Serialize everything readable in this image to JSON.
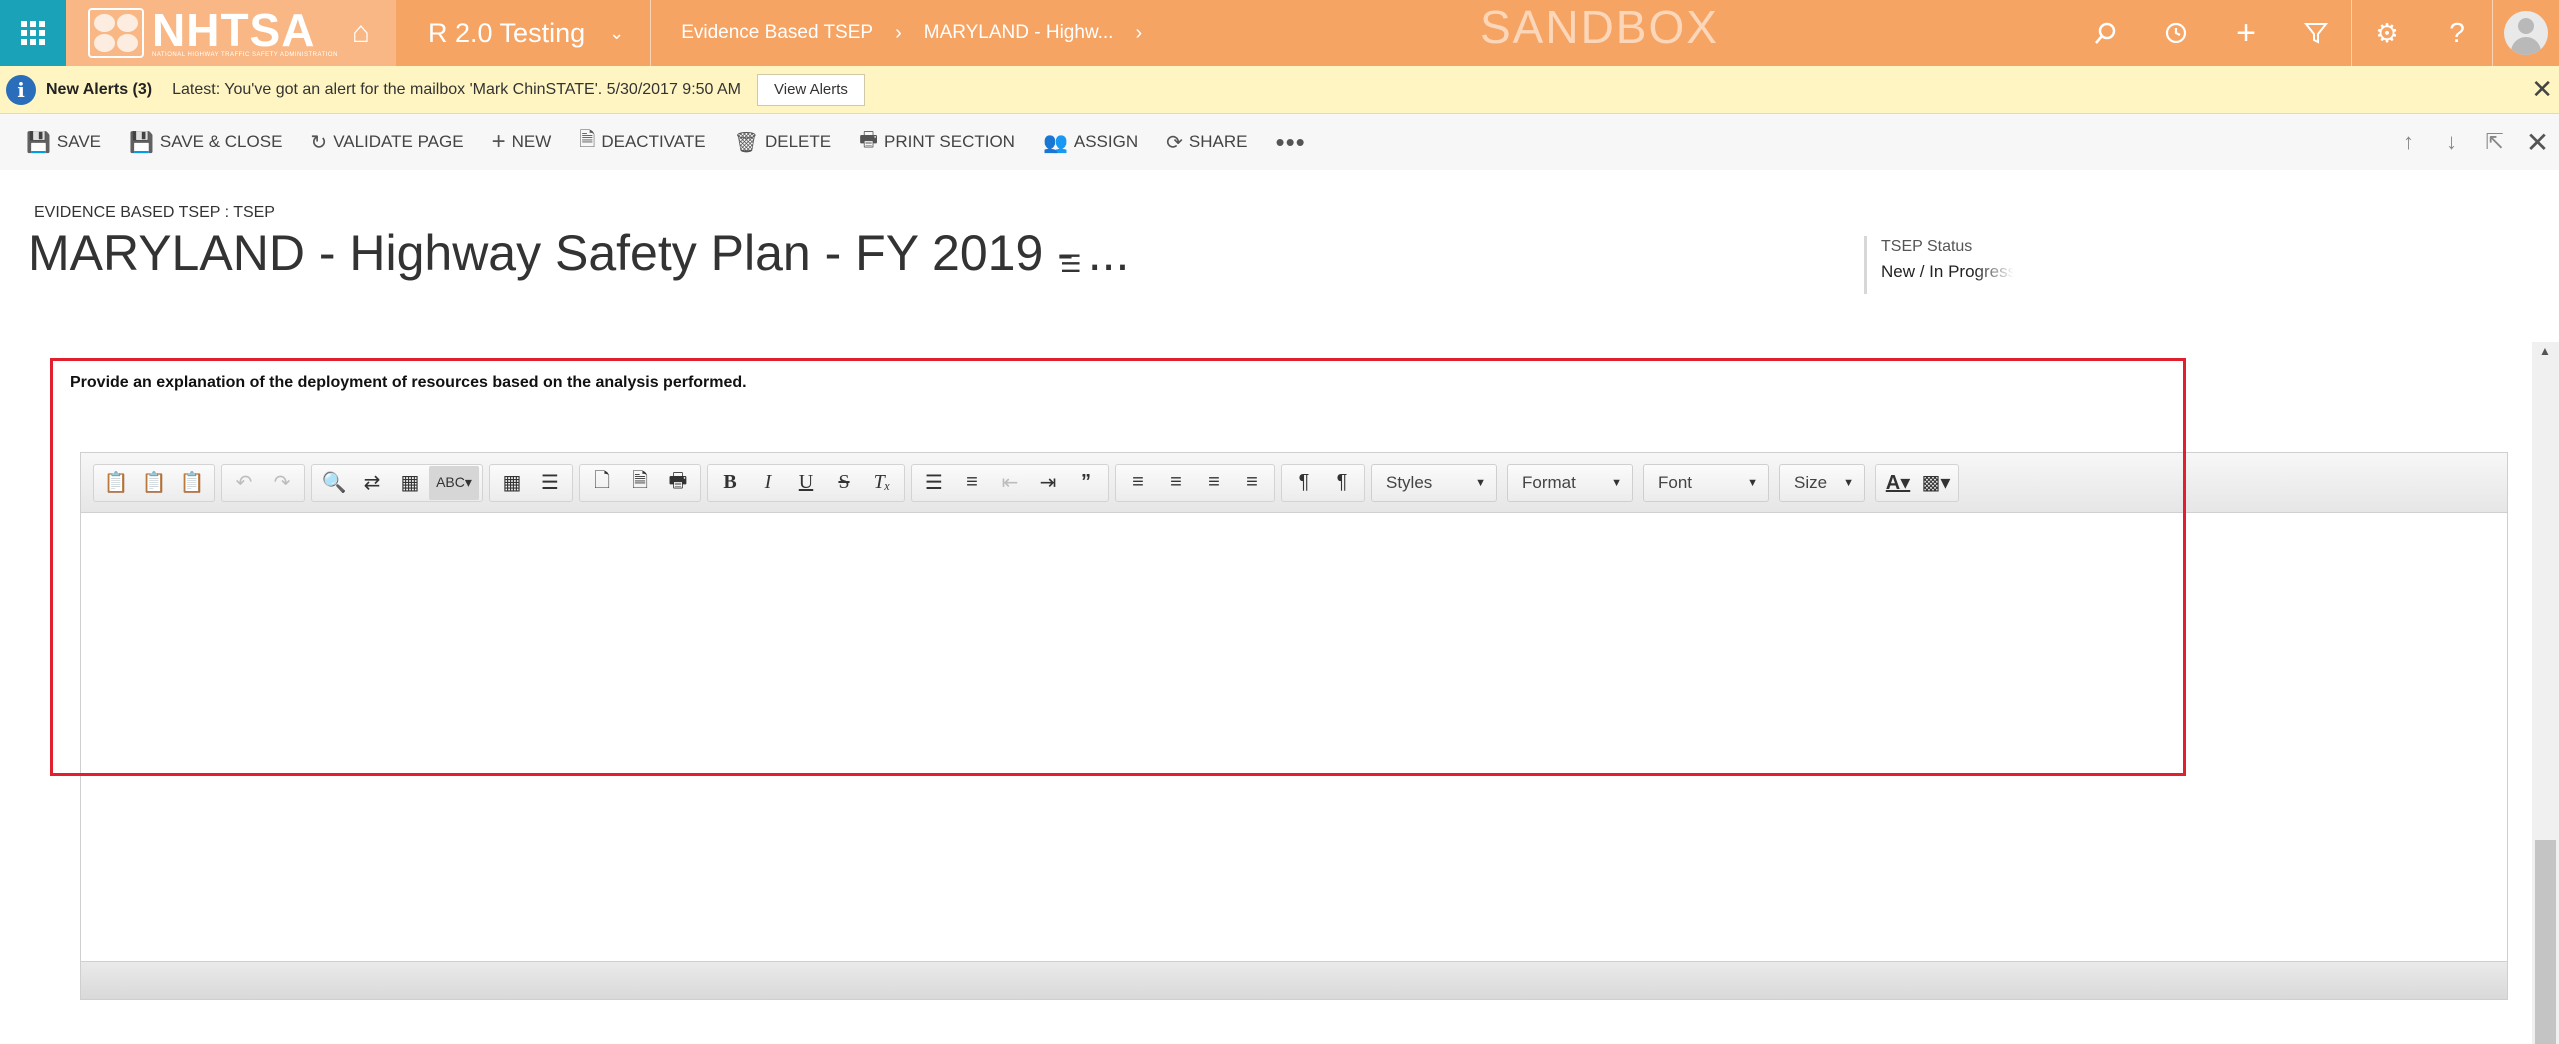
{
  "nav": {
    "brand_name": "NHTSA",
    "brand_sub": "NATIONAL HIGHWAY TRAFFIC SAFETY ADMINISTRATION",
    "app_name": "R 2.0 Testing",
    "breadcrumbs": [
      "Evidence Based TSEP",
      "MARYLAND - Highw..."
    ],
    "environment_label": "SANDBOX",
    "icons": [
      "search-icon",
      "recent-icon",
      "new-icon",
      "filter-icon",
      "settings-icon",
      "help-icon"
    ]
  },
  "alert": {
    "title": "New Alerts (3)",
    "message": "Latest: You've got an alert for the mailbox 'Mark ChinSTATE'. 5/30/2017 9:50 AM",
    "button": "View Alerts"
  },
  "commands": {
    "save": "SAVE",
    "save_close": "SAVE & CLOSE",
    "validate": "VALIDATE PAGE",
    "new": "NEW",
    "deactivate": "DEACTIVATE",
    "delete": "DELETE",
    "print": "PRINT SECTION",
    "assign": "ASSIGN",
    "share": "SHARE"
  },
  "header": {
    "entity_type": "EVIDENCE BASED TSEP : TSEP",
    "title": "MARYLAND - Highway Safety Plan - FY 2019 - ...",
    "status_label": "TSEP Status",
    "status_value": "New / In Progress"
  },
  "form": {
    "question": "Provide an explanation of the deployment of resources based on the analysis performed.",
    "editor_value": "",
    "dropdowns": {
      "styles": "Styles",
      "format": "Format",
      "font": "Font",
      "size": "Size"
    }
  },
  "colors": {
    "nav_bg": "#f6a464",
    "waffle_bg": "#1aa3b8",
    "alert_bg": "#fff5c2",
    "highlight": "#e0202f"
  }
}
